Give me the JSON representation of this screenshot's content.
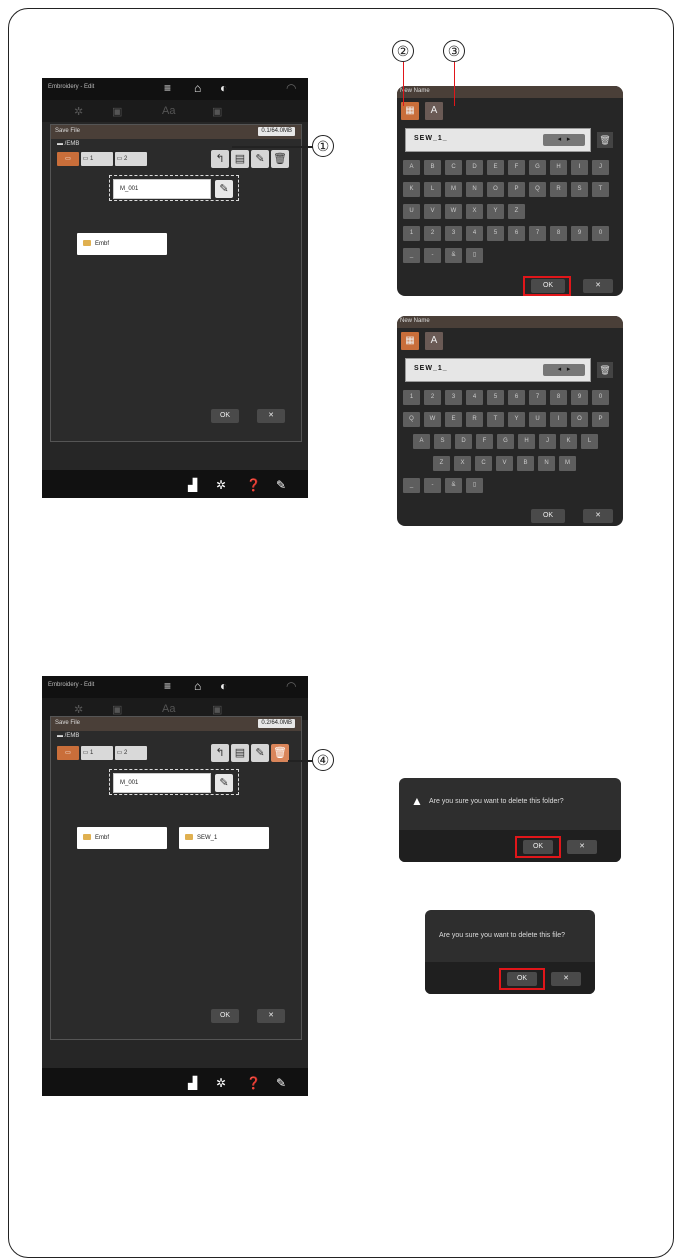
{
  "screen_a": {
    "title": "Embroidery - Edit",
    "dialog_title": "Save File",
    "capacity": "0.1/64.0MB",
    "path": "/EMB",
    "usb1": "1",
    "usb2": "2",
    "file_name": "M_001",
    "folders": [
      "Embf"
    ],
    "ok": "OK",
    "cancel": "✕"
  },
  "screen_b": {
    "title": "Embroidery - Edit",
    "dialog_title": "Save File",
    "capacity": "0.2/64.0MB",
    "path": "/EMB",
    "usb1": "1",
    "usb2": "2",
    "file_name": "M_001",
    "folders": [
      "Embf",
      "SEW_1"
    ],
    "ok": "OK",
    "cancel": "✕"
  },
  "kbd_alpha": {
    "header": "New Name",
    "entry": "SEW_1_",
    "rows": [
      [
        "A",
        "B",
        "C",
        "D",
        "E",
        "F",
        "G",
        "H",
        "I",
        "J"
      ],
      [
        "K",
        "L",
        "M",
        "N",
        "O",
        "P",
        "Q",
        "R",
        "S",
        "T"
      ],
      [
        "U",
        "V",
        "W",
        "X",
        "Y",
        "Z"
      ],
      [
        "1",
        "2",
        "3",
        "4",
        "5",
        "6",
        "7",
        "8",
        "9",
        "0"
      ],
      [
        "_",
        "-",
        "&",
        "▯"
      ]
    ],
    "ok": "OK",
    "cancel": "✕"
  },
  "kbd_qwerty": {
    "header": "New Name",
    "entry": "SEW_1_",
    "rows": [
      [
        "1",
        "2",
        "3",
        "4",
        "5",
        "6",
        "7",
        "8",
        "9",
        "0"
      ],
      [
        "Q",
        "W",
        "E",
        "R",
        "T",
        "Y",
        "U",
        "I",
        "O",
        "P"
      ],
      [
        "A",
        "S",
        "D",
        "F",
        "G",
        "H",
        "J",
        "K",
        "L"
      ],
      [
        "Z",
        "X",
        "C",
        "V",
        "B",
        "N",
        "M"
      ],
      [
        "_",
        "-",
        "&",
        "▯"
      ]
    ],
    "ok": "OK",
    "cancel": "✕"
  },
  "callouts": {
    "c1": "①",
    "c2": "②",
    "c3": "③",
    "c4": "④"
  },
  "popup_folder": {
    "message": "Are you sure you want to delete this folder?",
    "ok": "OK",
    "cancel": "✕"
  },
  "popup_file": {
    "message": "Are you sure you want to delete this file?",
    "ok": "OK",
    "cancel": "✕"
  }
}
